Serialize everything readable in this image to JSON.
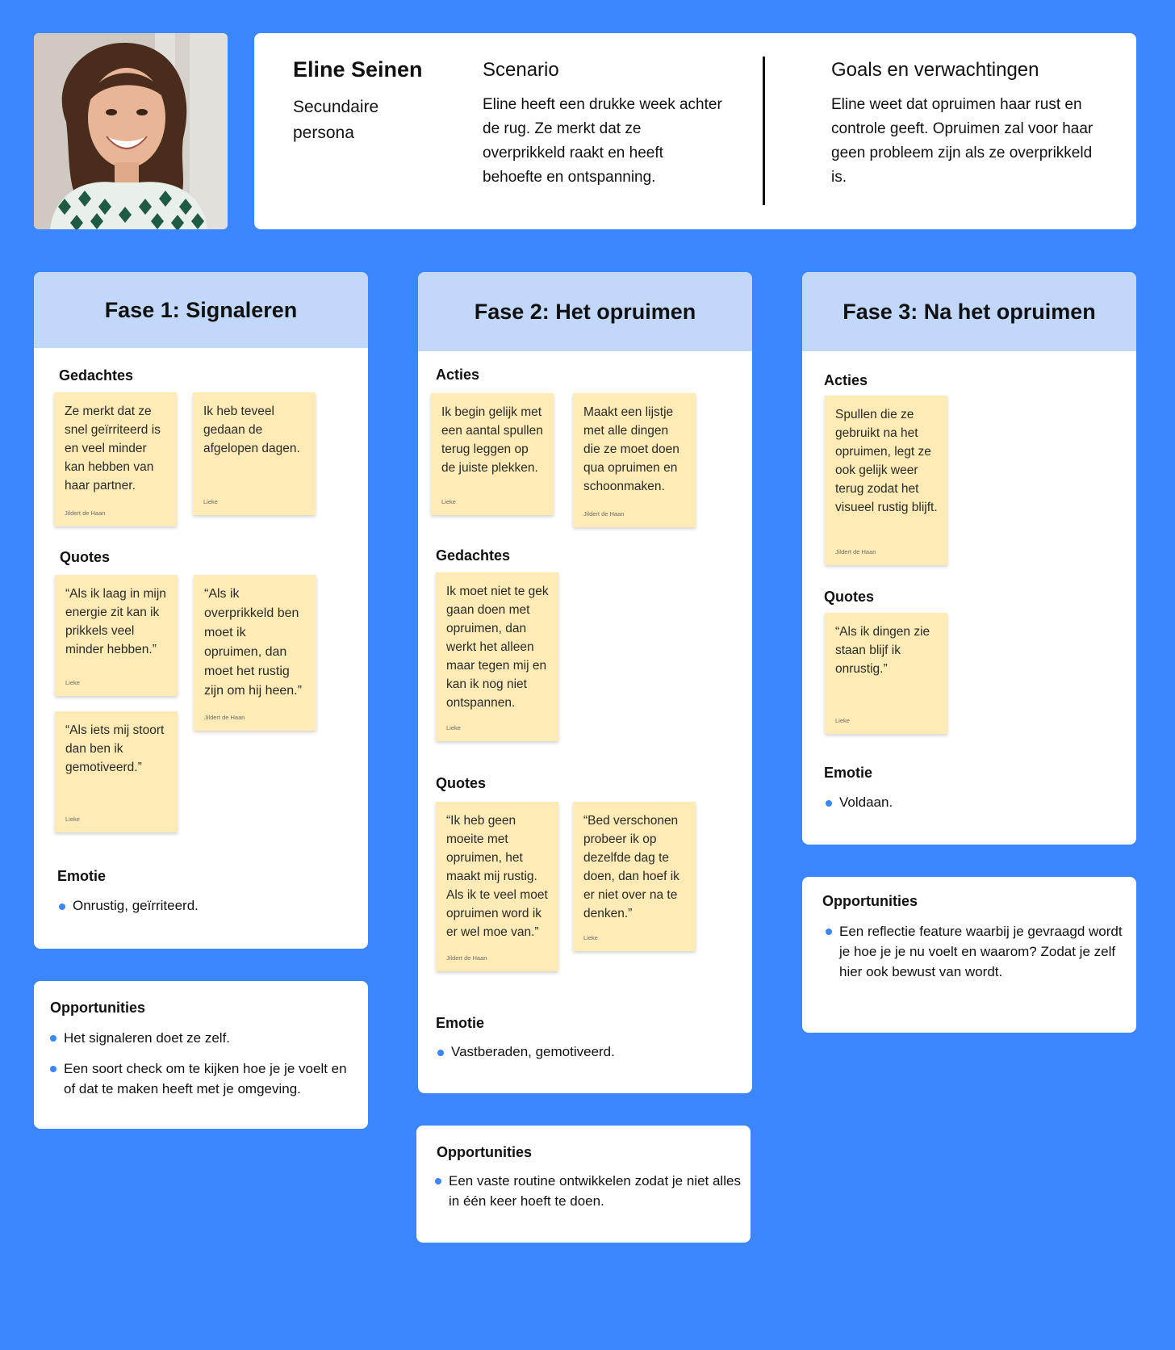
{
  "persona": {
    "name": "Eline Seinen",
    "role": "Secundaire persona",
    "scenario_title": "Scenario",
    "scenario_text": "Eline heeft een drukke week achter de rug. Ze merkt dat ze overprikkeld raakt en heeft behoefte en ontspanning.",
    "goals_title": "Goals en verwachtingen",
    "goals_text": "Eline weet dat opruimen haar rust en controle geeft. Opruimen zal voor haar geen probleem zijn als ze overprikkeld is."
  },
  "phases": [
    {
      "title": "Fase 1: Signaleren",
      "sec1_title": "Gedachtes",
      "sec1_notes": [
        {
          "text": "Ze merkt dat ze snel geïrriteerd is en veel minder kan hebben van haar partner.",
          "author": "Jildert de Haan"
        },
        {
          "text": "Ik heb teveel gedaan de afgelopen dagen.",
          "author": "Lieke"
        }
      ],
      "sec2_title": "Quotes",
      "sec2_notes": [
        {
          "text": "“Als ik laag in mijn energie zit kan ik prikkels veel minder hebben.”",
          "author": "Lieke"
        },
        {
          "text": "“Als ik overprikkeld ben moet ik opruimen, dan moet het rustig zijn om hij heen.”",
          "author": "Jildert de Haan"
        },
        {
          "text": "“Als iets mij stoort dan ben ik gemotiveerd.”",
          "author": "Lieke"
        }
      ],
      "emotion_title": "Emotie",
      "emotion": "Onrustig, geïrriteerd."
    },
    {
      "title": "Fase 2: Het opruimen",
      "sec1_title": "Acties",
      "sec1_notes": [
        {
          "text": "Ik begin gelijk met een aantal spullen terug leggen op de juiste plekken.",
          "author": "Lieke"
        },
        {
          "text": "Maakt een lijstje met alle dingen die ze moet doen qua opruimen en schoonmaken.",
          "author": "Jildert de Haan"
        }
      ],
      "sec2_title": "Gedachtes",
      "sec2_notes": [
        {
          "text": "Ik moet niet te gek gaan doen met opruimen, dan werkt het alleen maar tegen mij en kan ik nog niet ontspannen.",
          "author": "Lieke"
        }
      ],
      "sec3_title": "Quotes",
      "sec3_notes": [
        {
          "text": "“Ik heb geen moeite met opruimen, het maakt mij rustig. Als ik te veel moet opruimen word ik er wel moe van.”",
          "author": "Jildert de Haan"
        },
        {
          "text": "“Bed verschonen probeer ik op dezelfde dag te doen, dan hoef ik er niet over na te denken.”",
          "author": "Lieke"
        }
      ],
      "emotion_title": "Emotie",
      "emotion": "Vastberaden, gemotiveerd."
    },
    {
      "title": "Fase 3: Na het opruimen",
      "sec1_title": "Acties",
      "sec1_notes": [
        {
          "text": "Spullen die ze gebruikt na het opruimen, legt ze ook gelijk weer terug zodat het visueel rustig blijft.",
          "author": "Jildert de Haan"
        }
      ],
      "sec2_title": "Quotes",
      "sec2_notes": [
        {
          "text": "“Als ik dingen zie staan blijf ik onrustig.”",
          "author": "Lieke"
        }
      ],
      "emotion_title": "Emotie",
      "emotion": "Voldaan."
    }
  ],
  "opportunities": [
    {
      "title": "Opportunities",
      "items": [
        "Het signaleren doet ze zelf.",
        "Een soort check om te kijken hoe je je voelt en of dat te maken heeft met je omgeving."
      ]
    },
    {
      "title": "Opportunities",
      "items": [
        "Een vaste routine ontwikkelen zodat je niet alles in één keer hoeft te doen."
      ]
    },
    {
      "title": "Opportunities",
      "items": [
        "Een reflectie feature waarbij je gevraagd wordt je hoe je je nu voelt en waarom? Zodat je zelf hier ook bewust van wordt."
      ]
    }
  ],
  "colors": {
    "background": "#3b86fb",
    "phase_header": "#c2d8fb",
    "sticky_note": "#ffebb5",
    "bullet": "#3b86fb"
  }
}
